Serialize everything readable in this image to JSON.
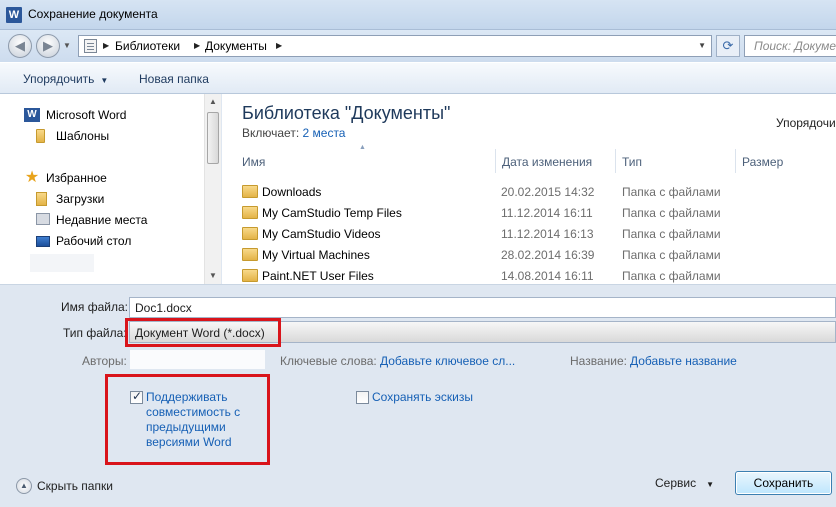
{
  "window": {
    "title": "Сохранение документа",
    "app_icon": "W"
  },
  "address": {
    "breadcrumbs": [
      "Библиотеки",
      "Документы"
    ],
    "search_placeholder": "Поиск: Документы"
  },
  "toolbar": {
    "organize_label": "Упорядочить",
    "new_folder_label": "Новая папка"
  },
  "nav": {
    "items": [
      {
        "label": "Microsoft Word",
        "icon": "word-icon"
      },
      {
        "label": "Шаблоны",
        "icon": "folder-icon"
      },
      {
        "label": "Избранное",
        "icon": "star-icon"
      },
      {
        "label": "Загрузки",
        "icon": "downloads-folder-icon"
      },
      {
        "label": "Недавние места",
        "icon": "recent-places-icon"
      },
      {
        "label": "Рабочий стол",
        "icon": "desktop-icon"
      }
    ]
  },
  "library": {
    "title": "Библиотека \"Документы\"",
    "includes_label": "Включает:",
    "includes_link": "2 места",
    "arrange_label": "Упорядочи"
  },
  "columns": {
    "name": "Имя",
    "date": "Дата изменения",
    "type": "Тип",
    "size": "Размер"
  },
  "files": [
    {
      "name": "Downloads",
      "date": "20.02.2015 14:32",
      "type": "Папка с файлами"
    },
    {
      "name": "My CamStudio Temp Files",
      "date": "11.12.2014 16:11",
      "type": "Папка с файлами"
    },
    {
      "name": "My CamStudio Videos",
      "date": "11.12.2014 16:13",
      "type": "Папка с файлами"
    },
    {
      "name": "My Virtual Machines",
      "date": "28.02.2014 16:39",
      "type": "Папка с файлами"
    },
    {
      "name": "Paint.NET User Files",
      "date": "14.08.2014 16:11",
      "type": "Папка с файлами"
    }
  ],
  "form": {
    "filename_label": "Имя файла:",
    "filename_value": "Doc1.docx",
    "filetype_label": "Тип файла:",
    "filetype_value": "Документ Word (*.docx)",
    "authors_label": "Авторы:",
    "authors_value": "",
    "keywords_label": "Ключевые слова:",
    "keywords_link": "Добавьте ключевое сл...",
    "title_label": "Название:",
    "title_link": "Добавьте название",
    "compat_label": "Поддерживать совместимость с предыдущими версиями Word",
    "compat_checked": true,
    "thumbnails_label": "Сохранять эскизы",
    "thumbnails_checked": false,
    "hide_folders_label": "Скрыть папки",
    "service_label": "Сервис",
    "save_label": "Сохранить"
  },
  "colors": {
    "highlight": "#d9141b",
    "link": "#1660b5",
    "library_title": "#1e395b"
  }
}
